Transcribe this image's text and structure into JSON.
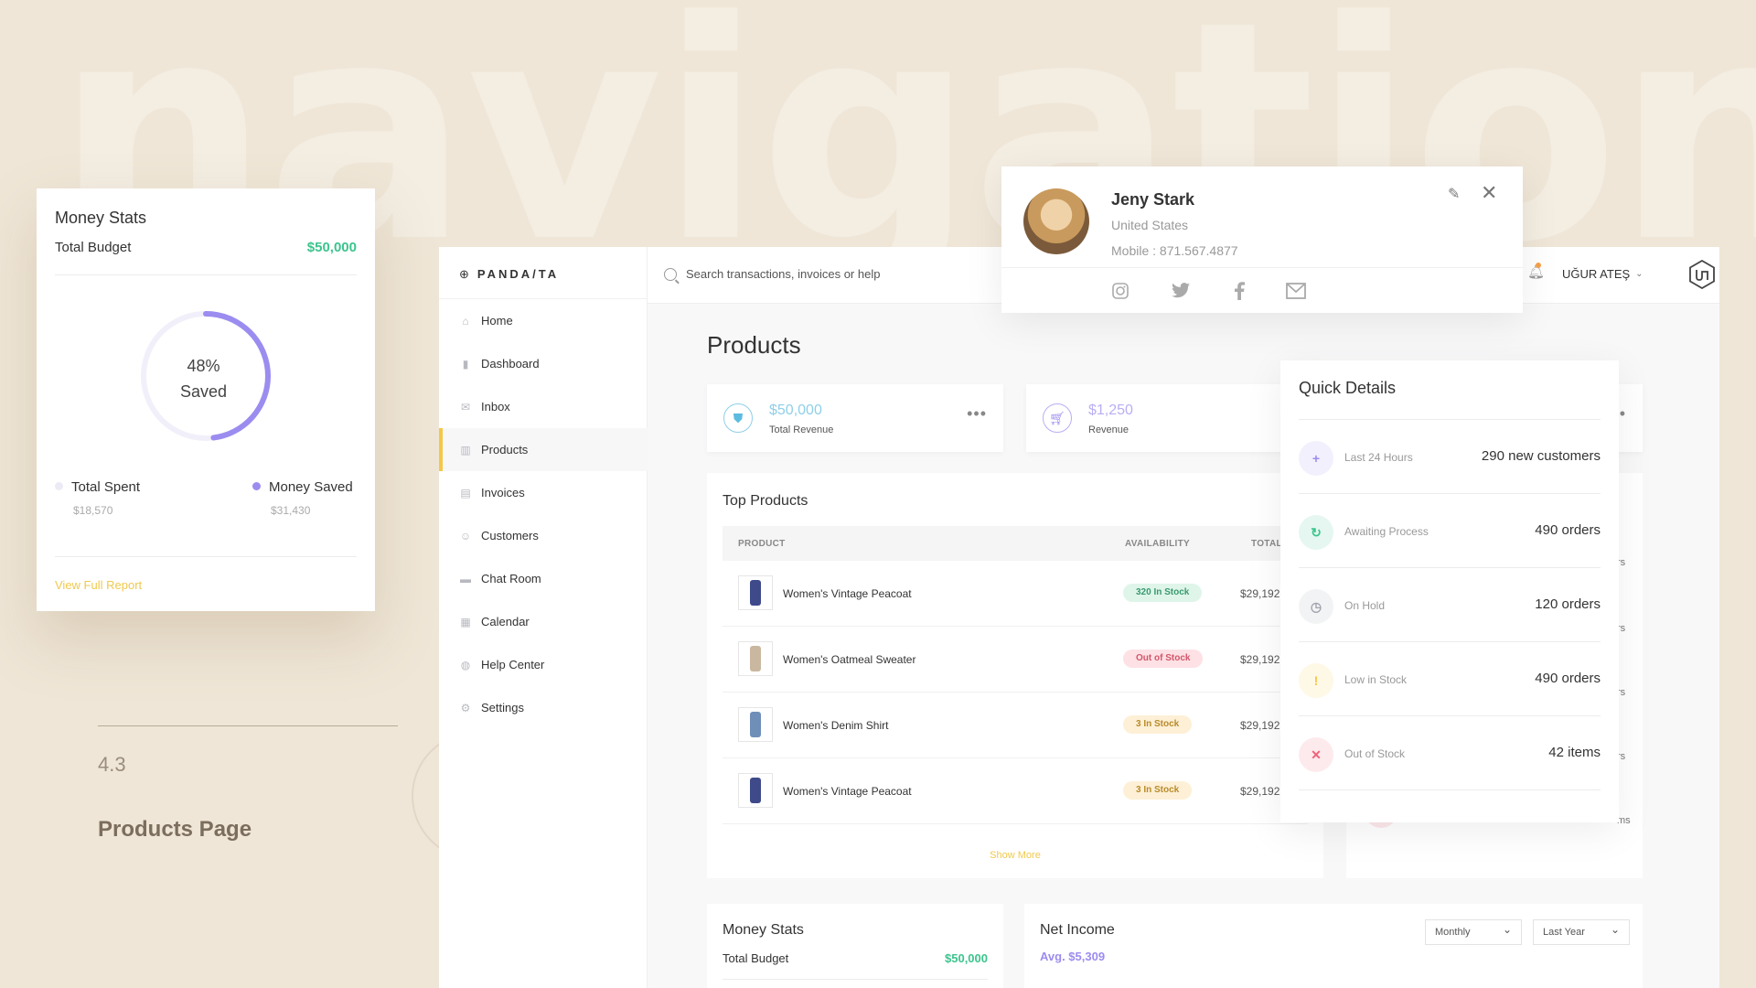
{
  "background_word": "navigation",
  "left_card": {
    "title": "Money Stats",
    "budget_label": "Total Budget",
    "budget_value": "$50,000",
    "donut_percent": "48%",
    "donut_label": "Saved",
    "saved_fraction": 0.48,
    "spent_label": "Total Spent",
    "spent_value": "$18,570",
    "saved_label": "Money Saved",
    "saved_value": "$31,430",
    "link": "View Full Report"
  },
  "section": {
    "number": "4.3",
    "title": "Products Page"
  },
  "app": {
    "logo": "PANDA/TA",
    "nav": [
      {
        "label": "Home",
        "icon": "home-icon"
      },
      {
        "label": "Dashboard",
        "icon": "chart-icon"
      },
      {
        "label": "Inbox",
        "icon": "mail-icon"
      },
      {
        "label": "Products",
        "icon": "barcode-icon"
      },
      {
        "label": "Invoices",
        "icon": "invoice-icon"
      },
      {
        "label": "Customers",
        "icon": "user-icon"
      },
      {
        "label": "Chat Room",
        "icon": "chat-icon"
      },
      {
        "label": "Calendar",
        "icon": "calendar-icon"
      },
      {
        "label": "Help Center",
        "icon": "globe-icon"
      },
      {
        "label": "Settings",
        "icon": "gear-icon"
      }
    ],
    "active_nav": "Products",
    "search_placeholder": "Search transactions, invoices or help",
    "user": "UĞUR ATEŞ",
    "page_title": "Products",
    "stats": [
      {
        "value": "$50,000",
        "label": "Total Revenue"
      },
      {
        "value": "$1,250",
        "label": "Revenue"
      }
    ],
    "top_products": {
      "title": "Top Products",
      "columns": [
        "PRODUCT",
        "AVAILABILITY",
        "TOTAL"
      ],
      "rows": [
        {
          "name": "Women's Vintage Peacoat",
          "availability": "320 In Stock",
          "status": "in",
          "total": "$29,192"
        },
        {
          "name": "Women's Oatmeal Sweater",
          "availability": "Out of Stock",
          "status": "out",
          "total": "$29,192"
        },
        {
          "name": "Women's Denim Shirt",
          "availability": "3 In Stock",
          "status": "low",
          "total": "$29,192"
        },
        {
          "name": "Women's Vintage Peacoat",
          "availability": "3 In Stock",
          "status": "low",
          "total": "$29,192"
        }
      ],
      "show_more": "Show More"
    },
    "money_stats": {
      "title": "Money Stats",
      "budget_label": "Total Budget",
      "budget_value": "$50,000"
    },
    "net_income": {
      "title": "Net Income",
      "avg": "Avg. $5,309",
      "period": "Monthly",
      "range": "Last Year"
    }
  },
  "profile": {
    "name": "Jeny Stark",
    "country": "United States",
    "mobile": "Mobile : 871.567.4877"
  },
  "quick_details": {
    "title": "Quick Details",
    "rows": [
      {
        "label": "Last 24 Hours",
        "value": "290 new customers",
        "color": "#9b8cf0"
      },
      {
        "label": "Awaiting Process",
        "value": "490 orders",
        "color": "#3cc48d"
      },
      {
        "label": "On Hold",
        "value": "120 orders",
        "color": "#a0a3ad"
      },
      {
        "label": "Low in Stock",
        "value": "490 orders",
        "color": "#f6c744"
      },
      {
        "label": "Out of Stock",
        "value": "42 items",
        "color": "#f0607a"
      }
    ]
  },
  "colors": {
    "accent": "#f6c744",
    "green": "#3cc48d",
    "purple": "#9b8cf0",
    "red": "#f0607a"
  }
}
